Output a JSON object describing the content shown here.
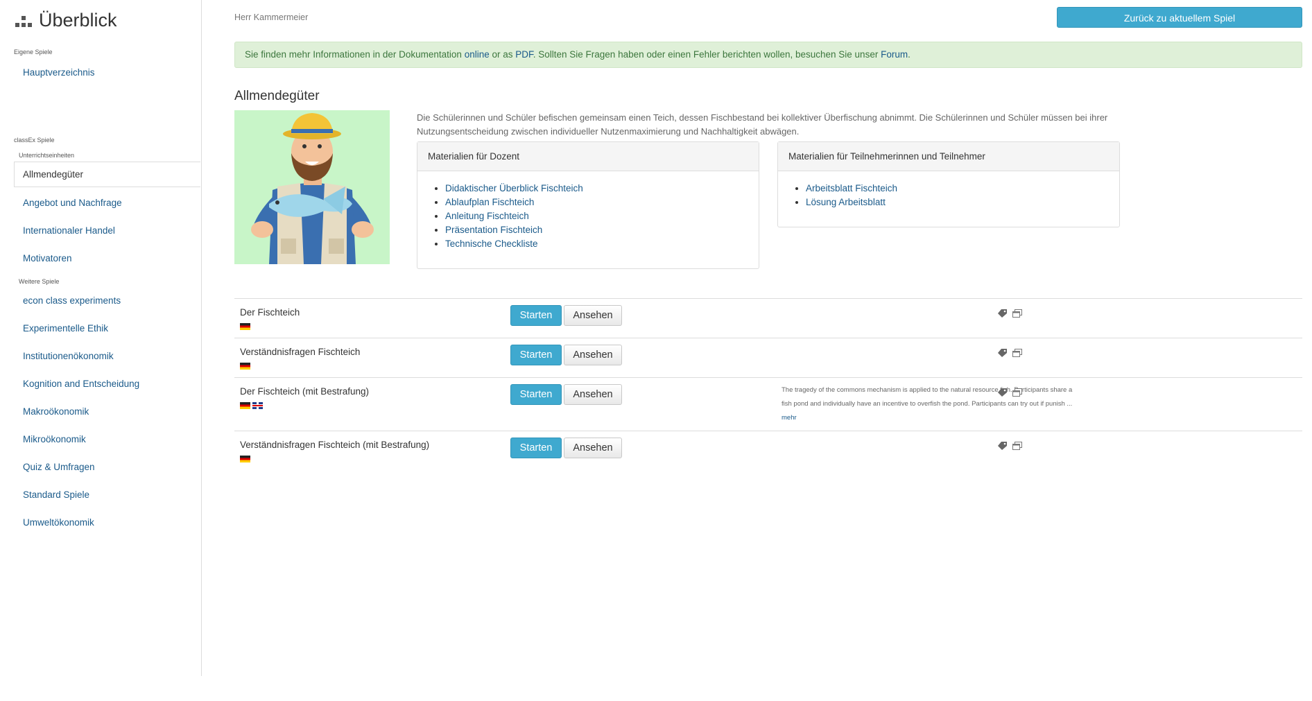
{
  "brand": {
    "title": "Überblick"
  },
  "sidebar": {
    "eigene_label": "Eigene Spiele",
    "hauptverzeichnis": "Hauptverzeichnis",
    "classex_label": "classEx Spiele",
    "unterricht_label": "Unterrichtseinheiten",
    "active_item": "Allmendegüter",
    "unterricht_items": [
      "Angebot und Nachfrage",
      "Internationaler Handel",
      "Motivatoren"
    ],
    "weitere_label": "Weitere Spiele",
    "weitere_items": [
      "econ class experiments",
      "Experimentelle Ethik",
      "Institutionenökonomik",
      "Kognition and Entscheidung",
      "Makroökonomik",
      "Mikroökonomik",
      "Quiz & Umfragen",
      "Standard Spiele",
      "Umweltökonomik"
    ]
  },
  "header": {
    "user": "Herr Kammermeier",
    "back_button": "Zurück zu aktuellem Spiel"
  },
  "info": {
    "text1": "Sie finden mehr Informationen in der Dokumentation ",
    "link_online": "online",
    "text2": " or as ",
    "link_pdf": "PDF",
    "text3": ". Sollten Sie Fragen haben oder einen Fehler berichten wollen, besuchen Sie unser ",
    "link_forum": "Forum",
    "text4": "."
  },
  "game": {
    "title": "Allmendegüter",
    "description": "Die Schülerinnen und Schüler befischen gemeinsam einen Teich, dessen Fischbestand bei kollektiver Überfischung abnimmt. Die Schülerinnen und Schüler müssen bei ihrer Nutzungsentscheidung zwischen individueller Nutzenmaximierung und Nachhaltigkeit abwägen."
  },
  "panels": {
    "dozent": {
      "title": "Materialien für Dozent",
      "links": [
        "Didaktischer Überblick Fischteich",
        "Ablaufplan Fischteich",
        "Anleitung Fischteich",
        "Präsentation Fischteich",
        "Technische Checkliste"
      ]
    },
    "teilnehmer": {
      "title": "Materialien für Teilnehmerinnen und Teilnehmer",
      "links": [
        "Arbeitsblatt Fischteich",
        "Lösung Arbeitsblatt"
      ]
    }
  },
  "games": [
    {
      "name": "Der Fischteich",
      "start": "Starten",
      "view": "Ansehen"
    },
    {
      "name": "Verständnisfragen Fischteich",
      "start": "Starten",
      "view": "Ansehen"
    },
    {
      "name": "Der Fischteich (mit Bestrafung)",
      "start": "Starten",
      "view": "Ansehen",
      "desc_line1": "The tragedy of the commons mechanism is applied to the natural resource fish. Participants share a",
      "desc_line2": "fish pond and individually have an incentive to overfish the pond. Participants can try out if punish ...",
      "more": "mehr"
    },
    {
      "name": "Verständnisfragen Fischteich (mit Bestrafung)",
      "start": "Starten",
      "view": "Ansehen"
    }
  ],
  "icons": {
    "brand": "sitemap-icon",
    "tag": "tag-icon",
    "copy": "copy-icon",
    "flag_de": "flag-de-icon",
    "flag_en": "flag-en-icon"
  },
  "colors": {
    "accent": "#3fa9cf",
    "link": "#1a5a8a",
    "info_bg": "#dff0d8",
    "info_text": "#3c763d"
  }
}
